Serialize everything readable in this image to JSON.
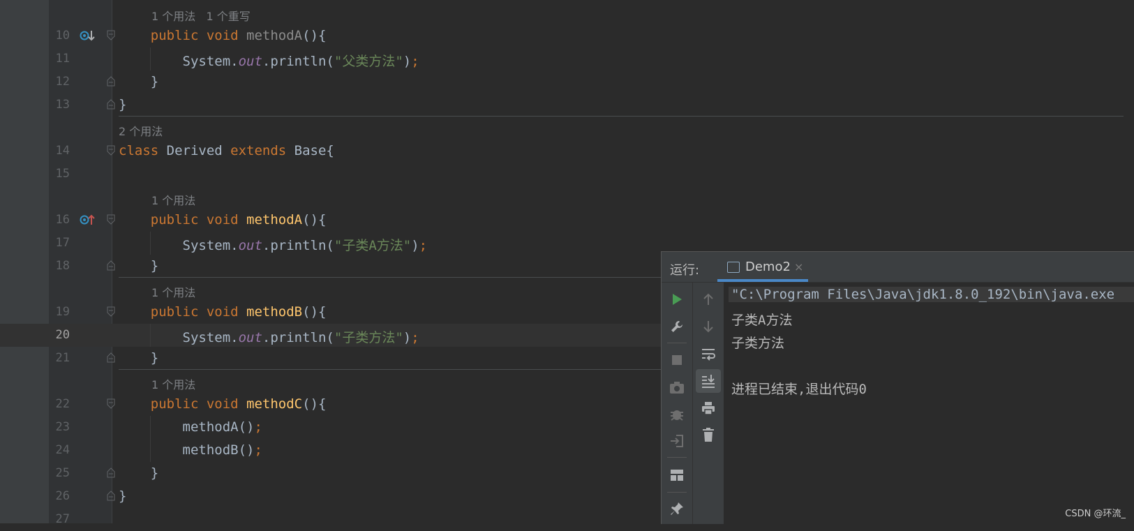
{
  "editor": {
    "lines": [
      {
        "type": "hint",
        "text": "1 个用法   1 个重写",
        "indent": 1
      },
      {
        "num": "10",
        "code": [
          {
            "t": "    "
          },
          {
            "t": "public ",
            "c": "kw"
          },
          {
            "t": "void ",
            "c": "kw"
          },
          {
            "t": "methodA",
            "c": "fn-dim"
          },
          {
            "t": "(){"
          }
        ],
        "gutter_icon": "override-down-icon"
      },
      {
        "num": "11",
        "code": [
          {
            "t": "        System."
          },
          {
            "t": "out",
            "c": "ital"
          },
          {
            "t": ".println("
          },
          {
            "t": "\"父类方法\"",
            "c": "str"
          },
          {
            "t": ")"
          },
          {
            "t": ";",
            "c": "semi"
          }
        ]
      },
      {
        "num": "12",
        "code": [
          {
            "t": "    }"
          }
        ]
      },
      {
        "num": "13",
        "code": [
          {
            "t": "}"
          }
        ],
        "sep_after": true
      },
      {
        "type": "hint",
        "text": "2 个用法",
        "indent": 0
      },
      {
        "num": "14",
        "code": [
          {
            "t": "class ",
            "c": "kw"
          },
          {
            "t": "Derived "
          },
          {
            "t": "extends ",
            "c": "kw"
          },
          {
            "t": "Base{"
          }
        ]
      },
      {
        "num": "15",
        "code": [
          {
            "t": ""
          }
        ]
      },
      {
        "type": "hint",
        "text": "1 个用法",
        "indent": 1
      },
      {
        "num": "16",
        "code": [
          {
            "t": "    "
          },
          {
            "t": "public ",
            "c": "kw"
          },
          {
            "t": "void ",
            "c": "kw"
          },
          {
            "t": "methodA",
            "c": "fn"
          },
          {
            "t": "(){"
          }
        ],
        "gutter_icon": "override-up-icon"
      },
      {
        "num": "17",
        "code": [
          {
            "t": "        System."
          },
          {
            "t": "out",
            "c": "ital"
          },
          {
            "t": ".println("
          },
          {
            "t": "\"子类A方法\"",
            "c": "str"
          },
          {
            "t": ")"
          },
          {
            "t": ";",
            "c": "semi"
          }
        ]
      },
      {
        "num": "18",
        "code": [
          {
            "t": "    }"
          }
        ],
        "sep_after": true
      },
      {
        "type": "hint",
        "text": "1 个用法",
        "indent": 1
      },
      {
        "num": "19",
        "code": [
          {
            "t": "    "
          },
          {
            "t": "public ",
            "c": "kw"
          },
          {
            "t": "void ",
            "c": "kw"
          },
          {
            "t": "methodB",
            "c": "fn"
          },
          {
            "t": "(){"
          }
        ]
      },
      {
        "num": "20",
        "code": [
          {
            "t": "        System."
          },
          {
            "t": "out",
            "c": "ital"
          },
          {
            "t": ".println("
          },
          {
            "t": "\"子类方法\"",
            "c": "str"
          },
          {
            "t": ")"
          },
          {
            "t": ";",
            "c": "semi"
          }
        ],
        "current": true
      },
      {
        "num": "21",
        "code": [
          {
            "t": "    }"
          }
        ],
        "sep_after": true
      },
      {
        "type": "hint",
        "text": "1 个用法",
        "indent": 1
      },
      {
        "num": "22",
        "code": [
          {
            "t": "    "
          },
          {
            "t": "public ",
            "c": "kw"
          },
          {
            "t": "void ",
            "c": "kw"
          },
          {
            "t": "methodC",
            "c": "fn"
          },
          {
            "t": "(){"
          }
        ]
      },
      {
        "num": "23",
        "code": [
          {
            "t": "        methodA()"
          },
          {
            "t": ";",
            "c": "semi"
          }
        ]
      },
      {
        "num": "24",
        "code": [
          {
            "t": "        methodB()"
          },
          {
            "t": ";",
            "c": "semi"
          }
        ]
      },
      {
        "num": "25",
        "code": [
          {
            "t": "    }"
          }
        ]
      },
      {
        "num": "26",
        "code": [
          {
            "t": "}"
          }
        ]
      },
      {
        "num": "27",
        "code": [
          {
            "t": ""
          }
        ]
      }
    ]
  },
  "run_panel": {
    "label": "运行:",
    "tab": {
      "label": "Demo2",
      "close": "×"
    },
    "toolbar_left": [
      "run-icon",
      "wrench-icon",
      "stop-icon",
      "camera-icon",
      "debug-icon",
      "login-icon",
      "layout-icon",
      "pin-icon"
    ],
    "toolbar_right": [
      "arrow-up-icon",
      "arrow-down-icon",
      "soft-wrap-icon",
      "scroll-to-end-icon",
      "print-icon",
      "trash-icon"
    ],
    "console": [
      "\"C:\\Program Files\\Java\\jdk1.8.0_192\\bin\\java.exe",
      "子类A方法",
      "子类方法",
      "",
      "进程已结束,退出代码0"
    ]
  },
  "watermark": "CSDN @环流_"
}
